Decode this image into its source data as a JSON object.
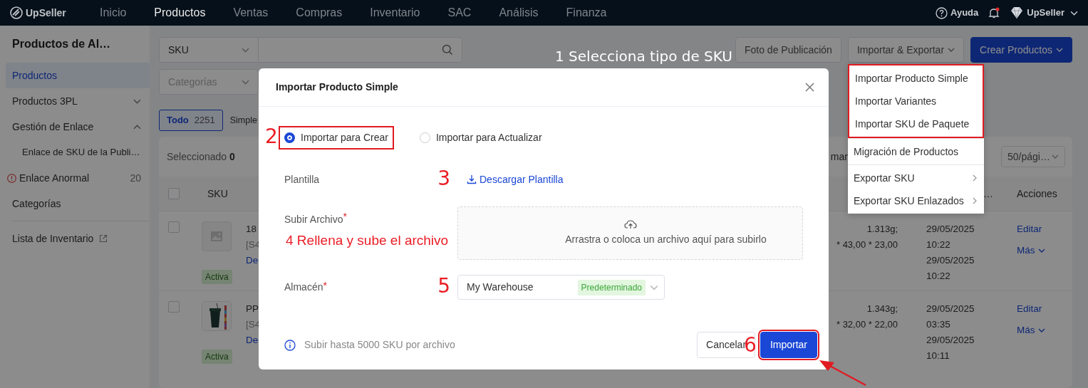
{
  "navbar": {
    "brand": "UpSeller",
    "items": [
      {
        "label": "Inicio",
        "selected": false
      },
      {
        "label": "Productos",
        "selected": true
      },
      {
        "label": "Ventas",
        "selected": false
      },
      {
        "label": "Compras",
        "selected": false
      },
      {
        "label": "Inventario",
        "selected": false
      },
      {
        "label": "SAC",
        "selected": false
      },
      {
        "label": "Análisis",
        "selected": false
      },
      {
        "label": "Finanza",
        "selected": false
      }
    ],
    "help": "Ayuda",
    "unread": true,
    "account": "UpSeller"
  },
  "sidebar": {
    "title": "Productos de Al…",
    "items": [
      {
        "kind": "item",
        "label": "Productos",
        "selected": true
      },
      {
        "kind": "group",
        "label": "Productos 3PL",
        "expanded": false,
        "selected": false
      },
      {
        "kind": "group",
        "label": "Gestión de Enlace",
        "expanded": true,
        "selected": false
      },
      {
        "kind": "sub",
        "label": "Enlace de SKU de la Publi…",
        "selected": false
      },
      {
        "kind": "alert",
        "label": "Enlace Anormal",
        "count": "20",
        "selected": false
      },
      {
        "kind": "item",
        "label": "Categorías",
        "selected": false
      },
      {
        "kind": "external",
        "label": "Lista de Inventario",
        "selected": false
      }
    ]
  },
  "toolbar": {
    "search_field": "SKU",
    "category_placeholder": "Categorías",
    "buttons": [
      {
        "label": "Foto de Publicación",
        "kind": "default"
      },
      {
        "label": "Importar & Exportar",
        "kind": "dropdown"
      },
      {
        "label": "Crear Productos",
        "kind": "primary"
      }
    ]
  },
  "filter_tabs": [
    {
      "label": "Todo",
      "count": "2251",
      "selected": true
    },
    {
      "label": "Simple",
      "selected": false
    }
  ],
  "table": {
    "selected_label": "Seleccionado",
    "selected_count": "0",
    "sort_label": "mar",
    "page_size": "50/pági…",
    "header_checked": false,
    "columns": [
      {
        "label": "SKU"
      },
      {
        "label": "…"
      },
      {
        "label": "Acciones"
      }
    ],
    "rows": [
      {
        "kind": "no-image",
        "checked": false,
        "status": "Activa",
        "name": "18",
        "sku": "[S4",
        "link": "De",
        "weight": "1.313g;",
        "dimensions": "* 43,00 * 23,00",
        "dates": [
          "29/05/2025",
          "10:22",
          "29/05/2025",
          "10:22"
        ],
        "actions": [
          "Editar",
          "Más"
        ]
      },
      {
        "checked": false,
        "status": "Activa",
        "name": "PP",
        "sku": "[S4",
        "link": "De",
        "weight": "1.343g;",
        "dimensions": "* 32,00 * 22,00",
        "dates": [
          "29/05/2025",
          "03:35",
          "29/05/2025",
          "10:11"
        ],
        "actions": [
          "Editar",
          "Más"
        ]
      }
    ]
  },
  "dropdown": {
    "annotation": "1 Selecciona tipo de SKU",
    "groups": [
      {
        "highlighted": true,
        "items": [
          {
            "label": "Importar Producto Simple",
            "submenu": false
          },
          {
            "label": "Importar Variantes",
            "submenu": false
          },
          {
            "label": "Importar SKU de Paquete",
            "submenu": false
          }
        ]
      },
      {
        "highlighted": false,
        "items": [
          {
            "label": "Migración de Productos",
            "submenu": false
          }
        ]
      },
      {
        "highlighted": false,
        "items": [
          {
            "label": "Exportar SKU",
            "submenu": true
          },
          {
            "label": "Exportar SKU Enlazados",
            "submenu": true
          }
        ]
      }
    ]
  },
  "modal": {
    "title": "Importar Producto Simple",
    "annotation": "2",
    "radios": [
      {
        "label": "Importar para Crear",
        "selected": true,
        "highlighted": true
      },
      {
        "label": "Importar para Actualizar",
        "selected": false,
        "highlighted": false
      }
    ],
    "fields": [
      {
        "kind": "link",
        "label": "Plantilla",
        "value": "Descargar Plantilla",
        "annotation": "3"
      },
      {
        "kind": "upload",
        "label": "Subir Archivo",
        "required_mark": "*",
        "value": "Arrastra o coloca un archivo aquí para subirlo",
        "annotation": "4 Rellena y sube el archivo"
      },
      {
        "kind": "select",
        "label": "Almacén",
        "required_mark": "*",
        "value": "My Warehouse",
        "tag": "Predeterminado",
        "annotation": "5"
      }
    ],
    "note": "Subir hasta 5000 SKU por archivo",
    "buttons": [
      {
        "label": "Cancelar",
        "kind": "default",
        "highlighted": false
      },
      {
        "label": "Importar",
        "kind": "primary",
        "highlighted": true,
        "annotation": "6",
        "arrow": true
      }
    ]
  }
}
